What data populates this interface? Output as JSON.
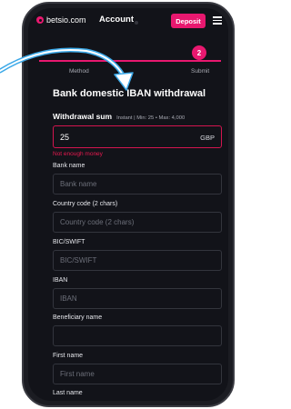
{
  "header": {
    "logo_text": "betsio.com",
    "title": "Account",
    "deposit_label": "Deposit"
  },
  "stepper": {
    "active_step": "2",
    "steps": [
      {
        "label": "Method"
      },
      {
        "label": "Submit"
      }
    ]
  },
  "form": {
    "title": "Bank domestic IBAN withdrawal",
    "sum_label": "Withdrawal sum",
    "sum_hint": "Instant | Min: 25 • Max: 4,000",
    "amount_value": "25",
    "currency": "GBP",
    "error": "Not enough money",
    "fields": [
      {
        "label": "Bank name",
        "placeholder": "Bank name"
      },
      {
        "label": "Country code (2 chars)",
        "placeholder": "Country code (2 chars)"
      },
      {
        "label": "BIC/SWIFT",
        "placeholder": "BIC/SWIFT"
      },
      {
        "label": "IBAN",
        "placeholder": "IBAN"
      },
      {
        "label": "Beneficiary name",
        "placeholder": ""
      },
      {
        "label": "First name",
        "placeholder": "First name"
      },
      {
        "label": "Last name",
        "placeholder": ""
      }
    ]
  },
  "colors": {
    "accent": "#e8186f",
    "background": "#121319",
    "error": "#e8184f",
    "arrow": "#3ca9e8"
  },
  "icons": {
    "menu": "hamburger-icon",
    "logo": "logo-icon",
    "pointer": "arrow-icon"
  }
}
